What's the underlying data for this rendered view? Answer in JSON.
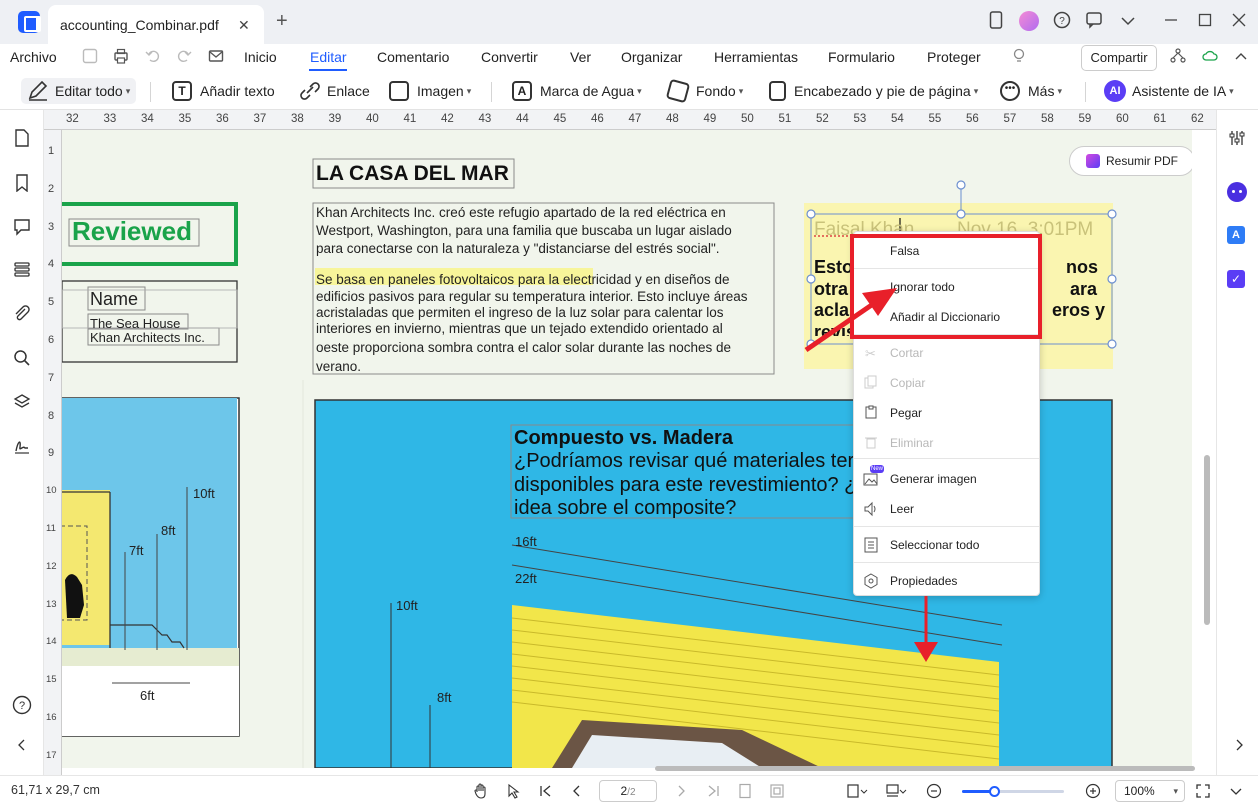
{
  "window": {
    "tab_title": "accounting_Combinar.pdf",
    "tab_close": "✕",
    "tab_add": "+"
  },
  "menu": {
    "archivo": "Archivo",
    "items": [
      "Inicio",
      "Editar",
      "Comentario",
      "Convertir",
      "Ver",
      "Organizar",
      "Herramientas",
      "Formulario",
      "Proteger"
    ],
    "active": "Editar",
    "share": "Compartir"
  },
  "toolbar": {
    "edit_all": "Editar todo",
    "add_text": "Añadir texto",
    "link": "Enlace",
    "image": "Imagen",
    "watermark": "Marca de Agua",
    "background": "Fondo",
    "header_footer": "Encabezado y pie de página",
    "more": "Más",
    "ai_assistant": "Asistente de IA",
    "ai_badge": "AI"
  },
  "ruler": {
    "top": [
      "32",
      "33",
      "34",
      "35",
      "36",
      "37",
      "38",
      "39",
      "40",
      "41",
      "42",
      "43",
      "44",
      "45",
      "46",
      "47",
      "48",
      "49",
      "50",
      "51",
      "52",
      "53",
      "54",
      "55",
      "56",
      "57",
      "58",
      "59",
      "60",
      "61",
      "62"
    ],
    "left": [
      "1",
      "2",
      "3",
      "4",
      "5",
      "6",
      "7",
      "8",
      "9",
      "10",
      "11",
      "12",
      "13",
      "14",
      "15",
      "16",
      "17"
    ]
  },
  "document": {
    "title": "LA CASA DEL MAR",
    "reviewed_stamp": "Reviewed",
    "name_label": "Name",
    "name_line1": "The Sea House",
    "name_line2": "Khan Architects Inc.",
    "para1_l1": "Khan Architects Inc. creó este refugio apartado de la red eléctrica en",
    "para1_l2": "Westport, Washington, para una familia que buscaba un lugar aislado",
    "para1_l3": "para conectarse con la naturaleza y \"distanciarse del estrés social\".",
    "para2_highlight": "Se basa en paneles fotovoltaicos para la ele",
    "para2_l1_rest": "ctricidad y en diseños de",
    "para2_l2": "edificios pasivos para regular su temperatura interior. Esto incluye áreas",
    "para2_l3": "acristaladas que permiten el ingreso de la luz solar para calentar los",
    "para2_l4": "interiores en invierno, mientras que un tejado extendido orientado al",
    "para2_l5": "oeste proporciona sombra contra el calor solar durante las noches de",
    "para2_l6": "verano.",
    "left_dims": [
      "10ft",
      "8ft",
      "7ft",
      "6ft"
    ],
    "main_dims": [
      "16ft",
      "22ft",
      "10ft",
      "8ft"
    ],
    "compuesto_title": "Compuesto vs. Madera",
    "compuesto_l1": "¿Podríamos revisar qué materiales ter",
    "compuesto_l2": "disponibles para este revestimiento? ¿",
    "compuesto_l3": "idea sobre el composite?",
    "note_author": "Faisal Khan",
    "note_date": "Nov 16, 3:01PM",
    "note_l1_start": "Esto",
    "note_l1_end": "nos",
    "note_l2_start": "otra",
    "note_l2_end": "ara",
    "note_l3_start": "aclar",
    "note_l3_end": "eros y",
    "note_l4_start": "revis",
    "resumir": "Resumir PDF"
  },
  "context_menu": {
    "falsa": "Falsa",
    "ignorar": "Ignorar todo",
    "anadir": "Añadir al Diccionario",
    "cortar": "Cortar",
    "copiar": "Copiar",
    "pegar": "Pegar",
    "eliminar": "Eliminar",
    "generar": "Generar imagen",
    "new_badge": "New",
    "leer": "Leer",
    "seleccionar": "Seleccionar todo",
    "propiedades": "Propiedades"
  },
  "status": {
    "page_size": "61,71 x 29,7 cm",
    "page_current": "2",
    "page_total": "/2",
    "zoom": "100%",
    "zoom_level": 0.32
  },
  "colors": {
    "accent": "#1f5cff",
    "annotation_red": "#e8202a",
    "stamp_green": "#1aa34a",
    "highlight_yellow": "#f7f59a",
    "sky_blue": "#2fb7e6",
    "wall_yellow": "#f2e64a"
  }
}
